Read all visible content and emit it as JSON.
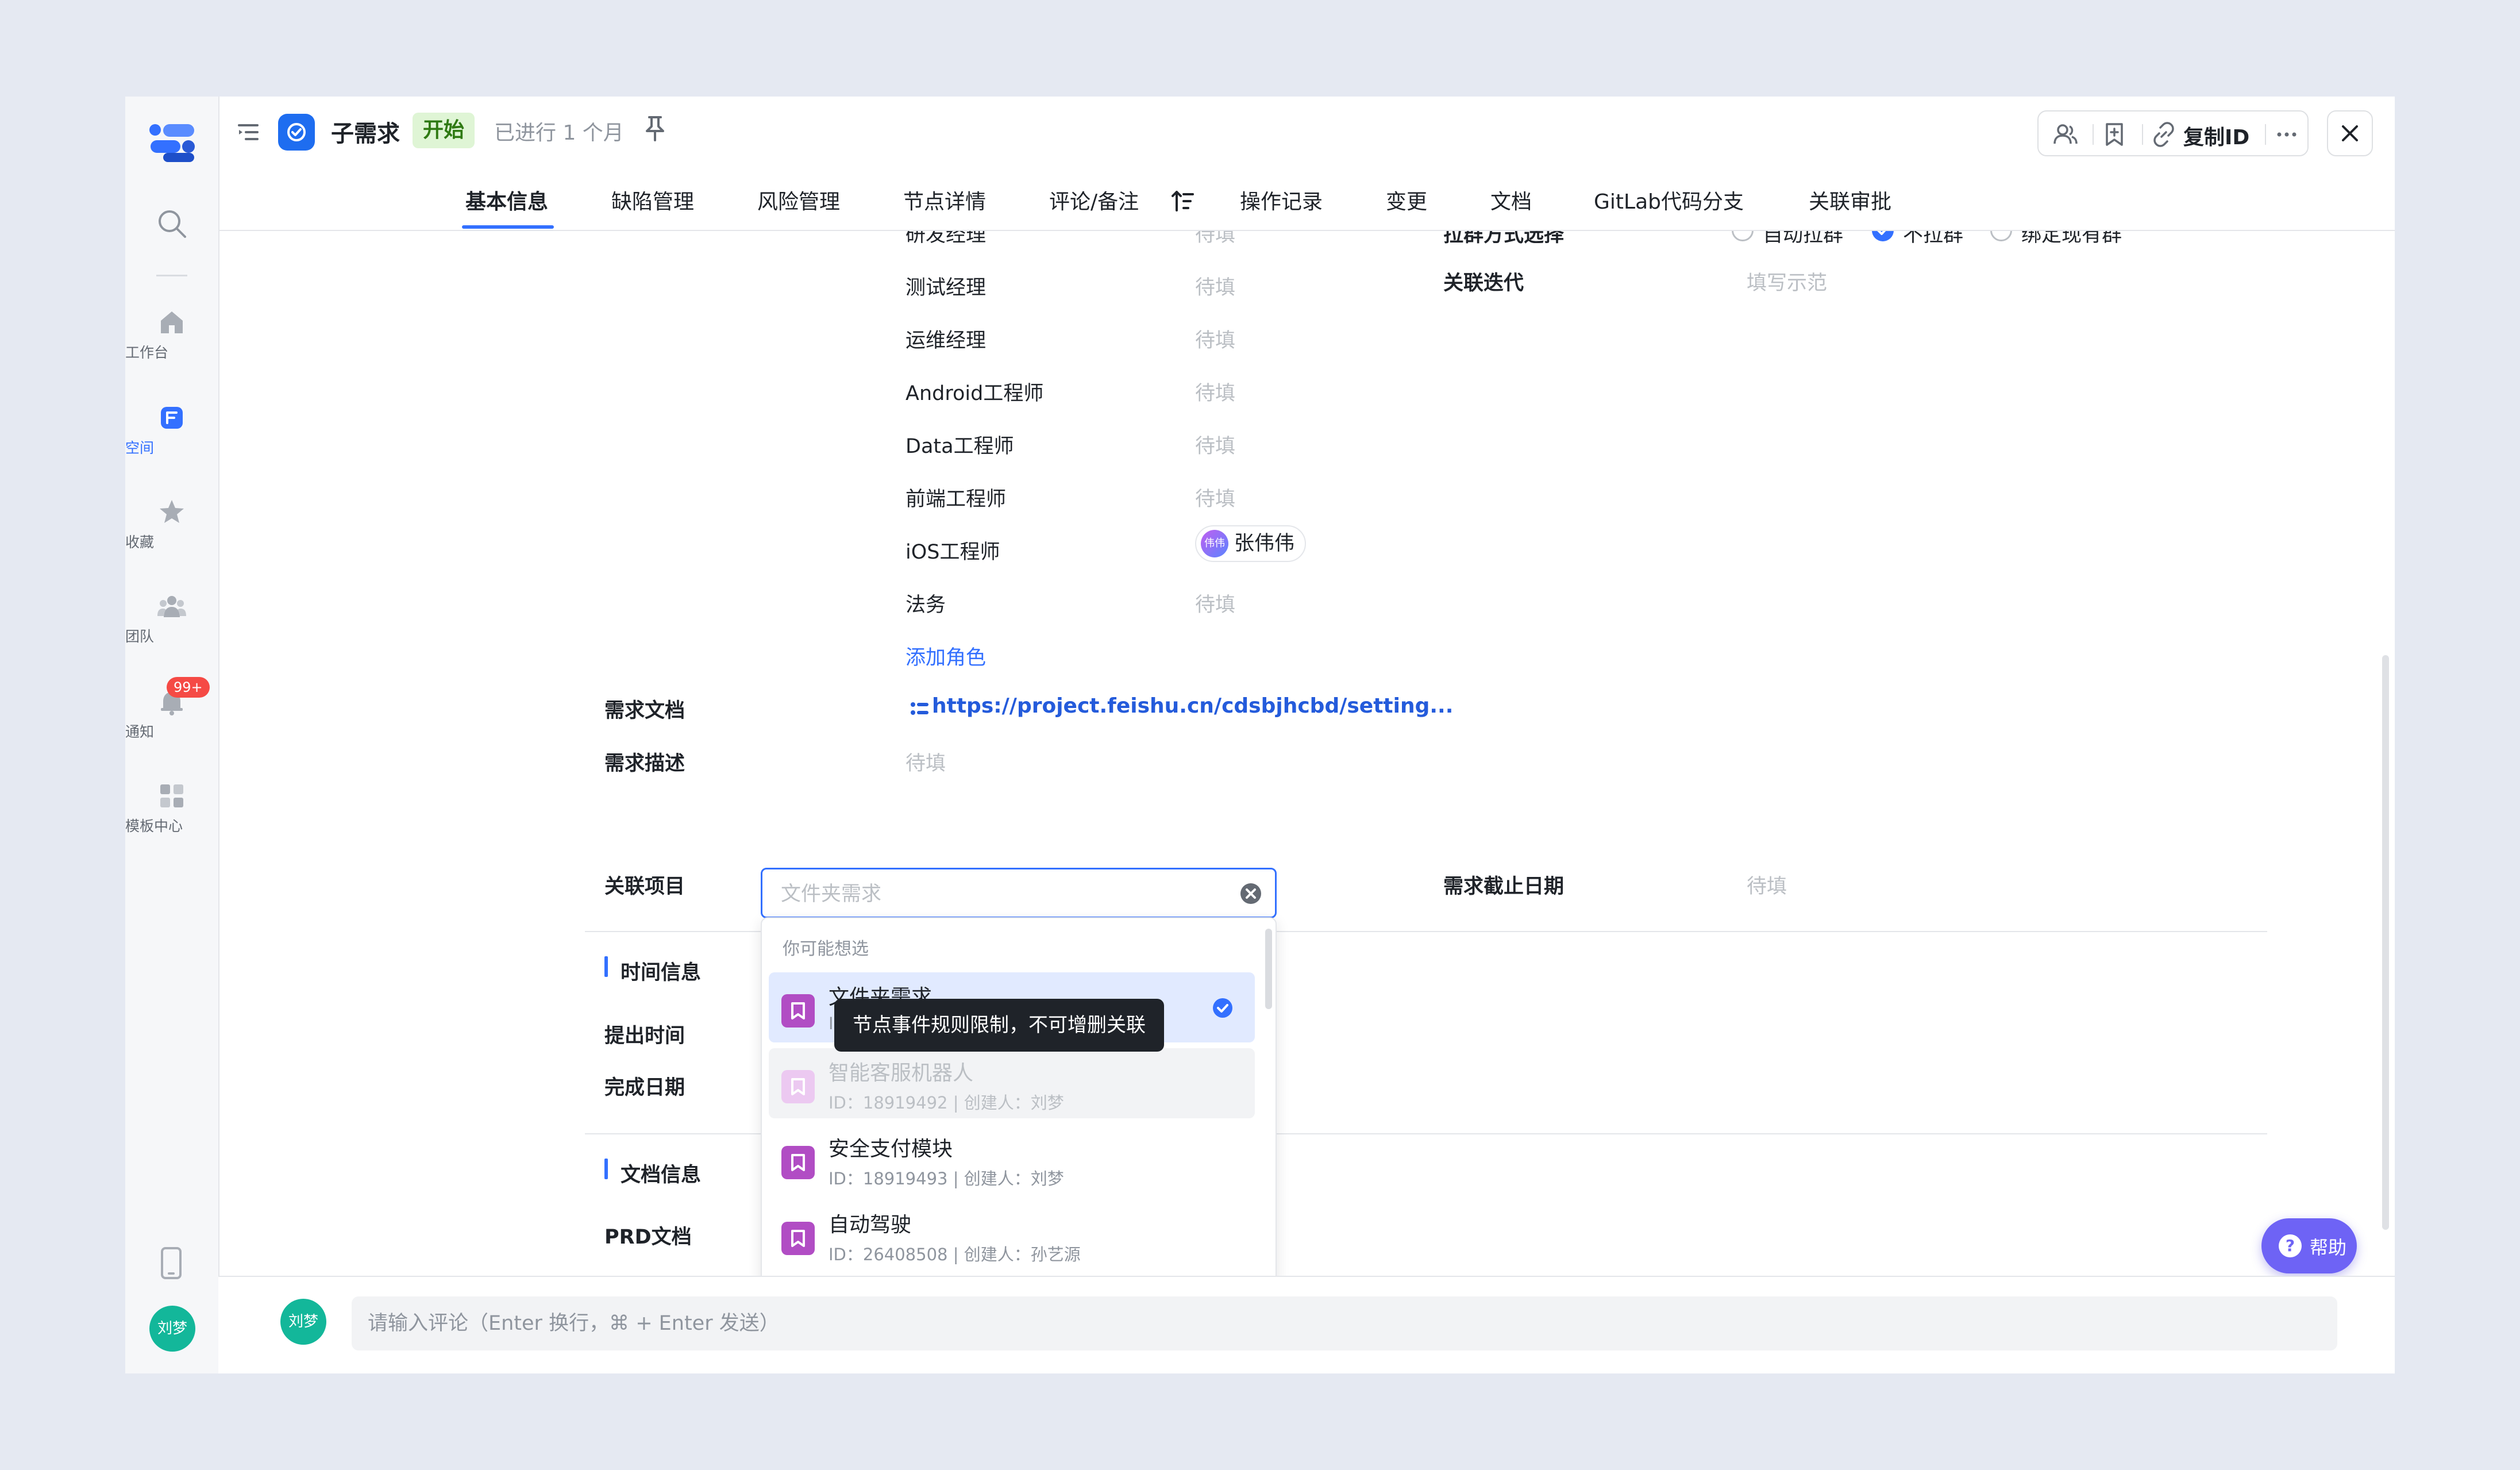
{
  "header": {
    "title": "子需求",
    "status": "开始",
    "elapsed": "已进行 1 个月",
    "copy_id": "复制ID"
  },
  "tabs": [
    {
      "label": "基本信息",
      "active": true
    },
    {
      "label": "缺陷管理"
    },
    {
      "label": "风险管理"
    },
    {
      "label": "节点详情"
    },
    {
      "label": "评论/备注"
    },
    {
      "label": "操作记录"
    },
    {
      "label": "变更"
    },
    {
      "label": "文档"
    },
    {
      "label": "GitLab代码分支"
    },
    {
      "label": "关联审批"
    }
  ],
  "sidebar": {
    "items": [
      {
        "label": "工作台",
        "icon": "home-icon"
      },
      {
        "label": "空间",
        "icon": "space-icon",
        "active": true
      },
      {
        "label": "收藏",
        "icon": "star-icon"
      },
      {
        "label": "团队",
        "icon": "team-icon"
      },
      {
        "label": "通知",
        "icon": "bell-icon",
        "badge": "99+"
      },
      {
        "label": "模板中心",
        "icon": "template-icon"
      }
    ],
    "avatar": "刘梦"
  },
  "roles": {
    "cut_top_label": "研发经理",
    "pending": "待填",
    "rows": [
      {
        "label": "测试经理",
        "value": "待填"
      },
      {
        "label": "运维经理",
        "value": "待填"
      },
      {
        "label": "Android工程师",
        "value": "待填"
      },
      {
        "label": "Data工程师",
        "value": "待填"
      },
      {
        "label": "前端工程师",
        "value": "待填"
      },
      {
        "label": "iOS工程师",
        "person": "张伟伟",
        "person_avatar": "伟伟"
      },
      {
        "label": "法务",
        "value": "待填"
      }
    ],
    "add_role": "添加角色"
  },
  "right_fields": {
    "group_method_label": "拉群方式选择",
    "group_options": [
      {
        "label": "自动拉群",
        "checked": false
      },
      {
        "label": "不拉群",
        "checked": true
      },
      {
        "label": "绑定现有群",
        "checked": false
      }
    ],
    "iteration_label": "关联迭代",
    "iteration_placeholder": "填写示范",
    "deadline_label": "需求截止日期",
    "deadline_value": "待填"
  },
  "fields": {
    "doc_label": "需求文档",
    "doc_link": "https://project.feishu.cn/cdsbjhcbd/setting...",
    "desc_label": "需求描述",
    "desc_value": "待填",
    "project_label": "关联项目",
    "project_placeholder": "文件夹需求"
  },
  "sections": {
    "time": {
      "title": "时间信息",
      "rows": [
        "提出时间",
        "完成日期"
      ]
    },
    "docs": {
      "title": "文档信息",
      "rows": [
        "PRD文档"
      ]
    }
  },
  "dropdown": {
    "heading": "你可能想选",
    "items": [
      {
        "name": "文件夹需求",
        "meta": "ID",
        "selected": true
      },
      {
        "name": "智能客服机器人",
        "meta": "ID：18919492 | 创建人：刘梦",
        "disabled": true
      },
      {
        "name": "安全支付模块",
        "meta": "ID：18919493 | 创建人：刘梦"
      },
      {
        "name": "自动驾驶",
        "meta": "ID：26408508 | 创建人：孙艺源"
      }
    ],
    "tooltip": "节点事件规则限制，不可增删关联"
  },
  "help": {
    "label": "帮助"
  },
  "comment": {
    "avatar": "刘梦",
    "placeholder": "请输入评论（Enter 换行，⌘ + Enter 发送）"
  },
  "colors": {
    "accent": "#3370ff",
    "status_bg": "#dff5d5",
    "item_icon": "#b14dc4",
    "badge": "#f54a45",
    "help": "#6e63f5",
    "avatar": "#13b79a"
  }
}
